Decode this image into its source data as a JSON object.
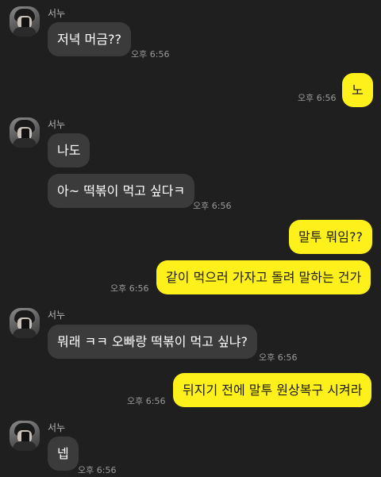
{
  "sender_name": "서누",
  "messages": [
    {
      "text": "저녁 머금??",
      "time": "오후 6:56"
    },
    {
      "text": "노",
      "time": "오후 6:56"
    },
    {
      "text": "나도"
    },
    {
      "text": "아~ 떡볶이 먹고 싶다ㅋ",
      "time": "오후 6:56"
    },
    {
      "text": "말투 뭐임??"
    },
    {
      "text": "같이 먹으러 가자고 돌려 말하는 건가",
      "time": "오후 6:56"
    },
    {
      "text": "뭐래 ㅋㅋ 오빠랑 떡볶이 먹고 싶냐?",
      "time": "오후 6:56"
    },
    {
      "text": "뒤지기 전에 말투 원상복구 시켜라",
      "time": "오후 6:56"
    },
    {
      "text": "넵",
      "time": "오후 6:56"
    }
  ],
  "colors": {
    "background": "#1f1f1f",
    "incoming_bubble": "#3b3b3b",
    "outgoing_bubble": "#fef01b"
  }
}
